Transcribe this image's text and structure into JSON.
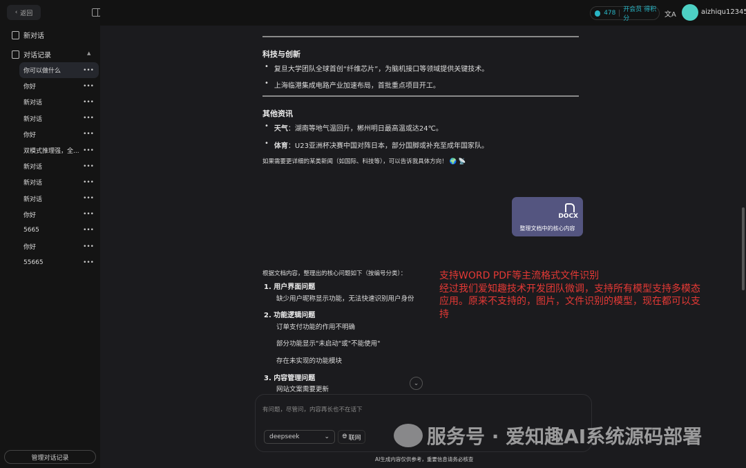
{
  "sidebar": {
    "back": "返回",
    "new_chat": "新对话",
    "history": "对话记录",
    "items": [
      "你可以做什么",
      "你好",
      "新对话",
      "新对话",
      "你好",
      "双模式推理强，全...",
      "新对话",
      "新对话",
      "新对话",
      "你好",
      "5665",
      "你好",
      "55665"
    ],
    "manage": "管理对话记录"
  },
  "topbar": {
    "points": "478",
    "vip": "开会员 得积分",
    "translate": "文A",
    "username": "aizhiqu123456"
  },
  "message": {
    "section_tech": "科技与创新",
    "tech": [
      "复旦大学团队全球首创“纤维芯片”，为脑机接口等领域提供关键技术。",
      "上海临港集成电路产业加速布局，首批重点项目开工。"
    ],
    "section_other": "其他资讯",
    "other": [
      {
        "label": "天气",
        "text": "：湖南等地气温回升，郴州明日最高温或达24℃。"
      },
      {
        "label": "体育",
        "text": "：U23亚洲杯决赛中国对阵日本，部分国脚或补充至成年国家队。"
      }
    ],
    "footer": "如果需要更详细的某类新闻（如国际、科技等），可以告诉我具体方向！ 🌍 📡"
  },
  "attachment": {
    "ext": "DOCX",
    "label": "整理文档中的核心内容"
  },
  "answer": {
    "intro": "根据文档内容，整理出的核心问题如下（按编号分类）：",
    "h1": "1. 用户界面问题",
    "s1": "缺少用户昵称显示功能，无法快速识别用户身份",
    "h2": "2. 功能逻辑问题",
    "s2a": "订单支付功能的作用不明确",
    "s2b": "部分功能显示\"未启动\"或\"不能使用\"",
    "s2c": "存在未实现的功能模块",
    "h3": "3. 内容管理问题",
    "s3": "网站文案需要更新"
  },
  "annotation": [
    "支持WORD PDF等主流格式文件识别",
    "经过我们爱知趣技术开发团队微调，支持所有模型支持多模态应用。原来不支持的，图片，文件识别的模型，现在都可以支持"
  ],
  "input": {
    "placeholder": "有问题，尽管问，内容再长也不在话下",
    "model": "deepseek",
    "web": "联网"
  },
  "disclaimer": "AI生成内容仅供参考，重要信息请务必核查",
  "watermark": "服务号 · 爱知趣AI系统源码部署"
}
